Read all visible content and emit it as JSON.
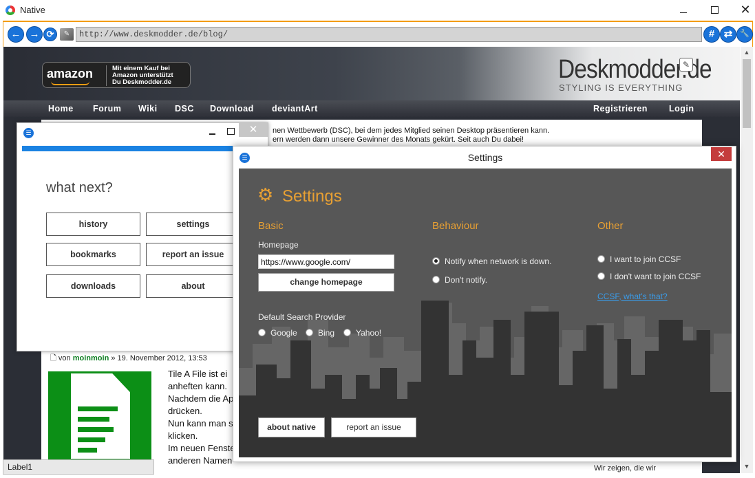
{
  "window": {
    "title": "Native",
    "minimize_glyph": "",
    "close_glyph": "✕",
    "accent_color": "#f39c12"
  },
  "nav": {
    "back_glyph": "←",
    "forward_glyph": "→",
    "refresh_glyph": "⟳",
    "tool_glyph": "✎",
    "url": "http://www.deskmodder.de/blog/",
    "hash_glyph": "#",
    "share_glyph": "⇄",
    "wrench_glyph": "🔧"
  },
  "website": {
    "amazon_logo": "amazon",
    "amazon_line1": "Mit einem Kauf bei",
    "amazon_line2": "Amazon unterstützt",
    "amazon_line3": "Du  Deskmodder.de",
    "logo": "Deskmodder.de",
    "tagline": "STYLING IS EVERYTHING",
    "menu": [
      "Home",
      "Forum",
      "Wiki",
      "DSC",
      "Download",
      "deviantArt"
    ],
    "menu_right": [
      "Registrieren",
      "Login"
    ],
    "intro_line1": "nen Wettbewerb (DSC), bei dem jedes Mitglied seinen Desktop präsentieren kann.",
    "intro_line2": "ern werden dann unsere Gewinner des Monats gekürt. Seit auch Du dabei!",
    "post_prefix": "von",
    "post_author": "moinmoin",
    "post_date": "» 19. November 2012, 13:53",
    "post_lines": [
      "Tile A File ist ei",
      "anheften kann.",
      "Nachdem die Ap",
      "drücken.",
      "Nun kann man se",
      "klicken.",
      "Im neuen Fenste",
      "anderen Namen"
    ],
    "right_snippet": "Wir zeigen, die wir"
  },
  "status": {
    "label": "Label1"
  },
  "what_next": {
    "heading": "what next?",
    "close_glyph": "✕",
    "buttons": [
      "history",
      "settings",
      "bookmarks",
      "report an issue",
      "downloads",
      "about"
    ]
  },
  "settings": {
    "window_title": "Settings",
    "close_glyph": "✕",
    "heading": "Settings",
    "gear_glyph": "⚙",
    "basic": {
      "title": "Basic",
      "homepage_label": "Homepage",
      "homepage_value": "https://www.google.com/",
      "change_button": "change homepage",
      "search_label": "Default Search Provider",
      "providers": [
        "Google",
        "Bing",
        "Yahoo!"
      ]
    },
    "behaviour": {
      "title": "Behaviour",
      "options": [
        "Notify when network is down.",
        "Don't notify."
      ],
      "selected": 0
    },
    "other": {
      "title": "Other",
      "options": [
        "I want to join CCSF",
        "I don't want to join CCSF"
      ],
      "link": "CCSF, what's that?"
    },
    "about_button": "about native",
    "report_button": "report an issue",
    "orange": "#e8a033"
  }
}
